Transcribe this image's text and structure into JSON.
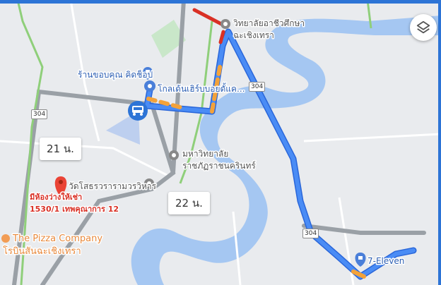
{
  "map": {
    "places": {
      "college": "วิทยาลัยอาชีวศึกษา",
      "college_city": "ฉะเชิงเทรา",
      "shop": "ร้านขอบคุณ คิดช็อป",
      "school": "โกลเด้นเฮิร์บบอยดั้แค...",
      "university_line1": "มหาวิทยาลัย",
      "university_line2": "ราชภัฏราชนครินทร์",
      "temple": "วัดโสธรวรารามวรวิหาร",
      "pizza_line1": "The Pizza Company",
      "pizza_line2": "โรบินสันฉะเชิงเทรา",
      "seven_eleven": "7-Eleven"
    },
    "marker_text": {
      "line1": "มีห้องว่างให้เช่า",
      "line2": "1530/1 เทพคุณาการ 12"
    },
    "eta": {
      "car": "21 น.",
      "other": "22 น."
    },
    "road_shields": [
      "304",
      "304",
      "304"
    ],
    "colors": {
      "route": "#3f7ff0",
      "traffic_slow": "#f3a23a",
      "traffic_heavy": "#d93025",
      "water": "#a5c7f2",
      "marker": "#ea4335"
    }
  }
}
